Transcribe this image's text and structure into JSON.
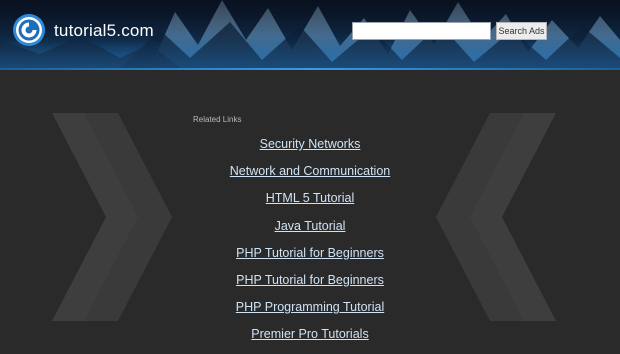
{
  "header": {
    "site_name": "tutorial5.com",
    "logo_icon": "circular-swirl-logo",
    "accent_color": "#2f8ad8"
  },
  "search": {
    "value": "",
    "placeholder": "",
    "button_label": "Search Ads"
  },
  "related": {
    "label": "Related Links",
    "links": [
      "Security Networks",
      "Network and Communication",
      "HTML 5 Tutorial",
      "Java Tutorial",
      "PHP Tutorial for Beginners",
      "PHP Tutorial for Beginners",
      "PHP Programming Tutorial",
      "Premier Pro Tutorials"
    ]
  },
  "decorations": {
    "left_icon": "double-chevron-right-icon",
    "right_icon": "double-chevron-left-icon"
  }
}
